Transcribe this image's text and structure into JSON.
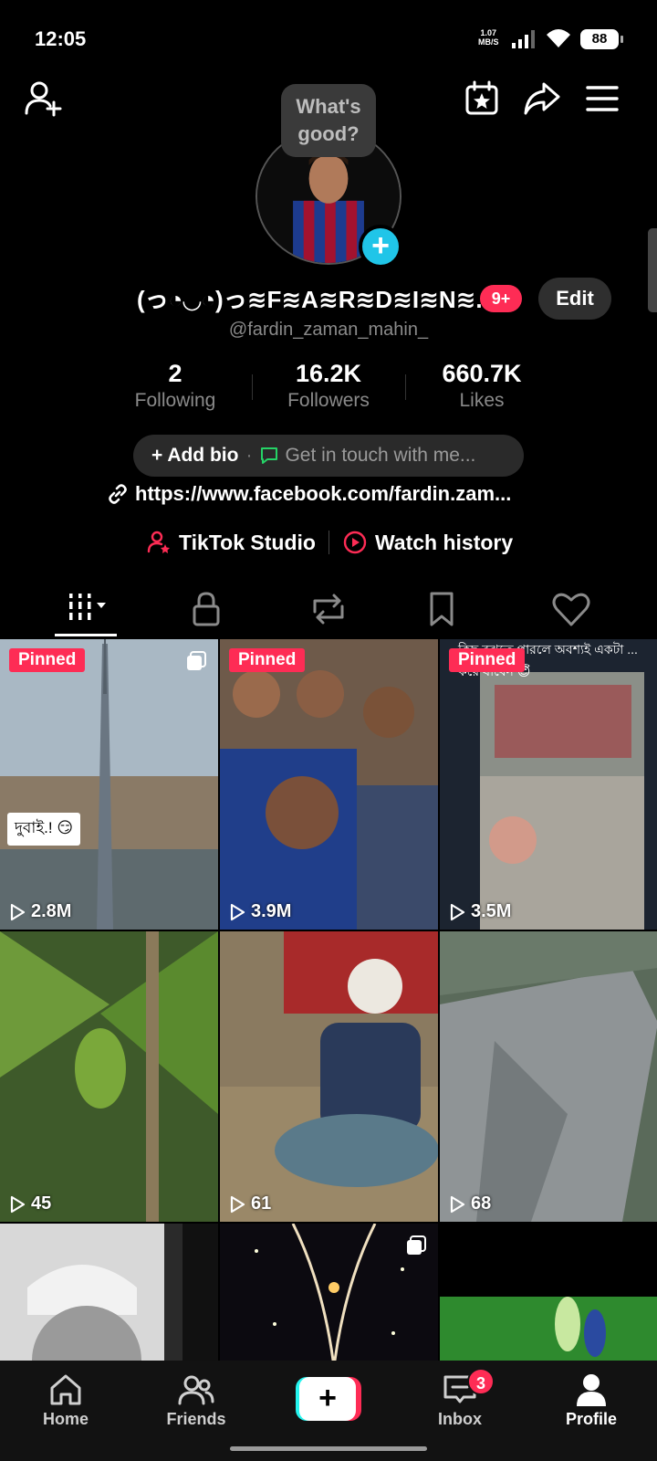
{
  "status_bar": {
    "time": "12:05",
    "net_speed_value": "1.07",
    "net_speed_unit": "MB/S",
    "battery": "88"
  },
  "profile": {
    "status_bubble_line1": "What's",
    "status_bubble_line2": "good?",
    "display_name": "(っ◔◡◔)っ≋F≋A≋R≋D≋I≋N≋...",
    "notification_badge": "9+",
    "edit_label": "Edit",
    "username": "@fardin_zaman_mahin_",
    "stats": [
      {
        "value": "2",
        "label": "Following"
      },
      {
        "value": "16.2K",
        "label": "Followers"
      },
      {
        "value": "660.7K",
        "label": "Likes"
      }
    ],
    "add_bio": "+ Add bio",
    "bio_separator": "·",
    "get_in_touch": "Get in touch with me...",
    "link": "https://www.facebook.com/fardin.zam...",
    "studio_label": "TikTok Studio",
    "watch_history_label": "Watch history"
  },
  "tabs": [
    "videos-tab",
    "private-tab",
    "reposts-tab",
    "favorites-tab",
    "liked-tab"
  ],
  "videos": [
    {
      "pinned": "Pinned",
      "views": "2.8M",
      "caption": "দুবাই.! 😏"
    },
    {
      "pinned": "Pinned",
      "views": "3.9M"
    },
    {
      "pinned": "Pinned",
      "views": "3.5M",
      "overlay": "কিছু বুঝতে পারলে অবশ্যই একটা ... করে যাবেন 😇"
    },
    {
      "views": "45"
    },
    {
      "views": "61"
    },
    {
      "views": "68"
    },
    {
      "views": ""
    },
    {
      "views": ""
    },
    {
      "views": ""
    }
  ],
  "bottom_nav": {
    "home": "Home",
    "friends": "Friends",
    "create": "+",
    "inbox": "Inbox",
    "inbox_badge": "3",
    "profile": "Profile"
  },
  "colors": {
    "accent": "#fe2c55",
    "cyan": "#25f4ee",
    "avatar_add": "#20c5e8",
    "background": "#000000"
  }
}
